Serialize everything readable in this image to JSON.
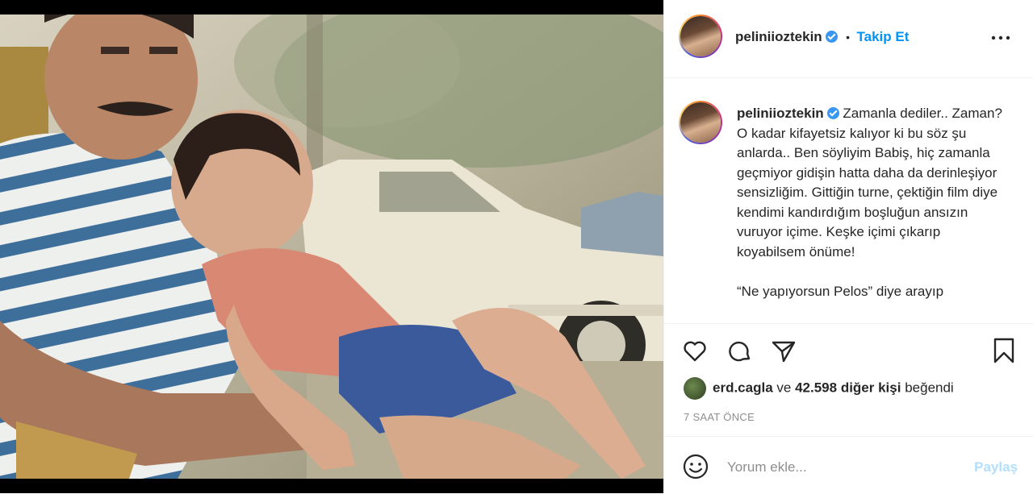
{
  "post": {
    "username": "peliniioztekin",
    "follow_label": "Takip Et",
    "dot": "•",
    "more_icon": "more-horizontal-icon",
    "caption_user": "peliniioztekin",
    "caption_text": " Zamanla dediler.. Zaman? O kadar kifayetsiz kalıyor ki bu söz şu anlarda.. Ben söyliyim Babiş, hiç zamanla geçmiyor gidişin hatta daha da derinleşiyor sensizliğim. Gittiğin turne, çektiğin film diye kendimi kandırdığım boşluğun ansızın vuruyor içime. Keşke içimi çıkarıp koyabilsem önüme!\n\n“Ne yapıyorsun Pelos” diye arayıp",
    "icons": [
      "heart-icon",
      "comment-icon",
      "share-icon",
      "bookmark-icon",
      "emoji-icon",
      "verified-icon"
    ]
  },
  "likes": {
    "liker": "erd.cagla",
    "connector": "ve",
    "count_text": "42.598 diğer kişi",
    "suffix": "beğendi"
  },
  "timestamp": "7 SAAT ÖNCE",
  "comment": {
    "placeholder": "Yorum ekle...",
    "share_label": "Paylaş"
  },
  "colors": {
    "accent": "#0095f6",
    "share_disabled": "#b2dffc",
    "text": "#262626",
    "muted": "#8e8e8e",
    "border": "#efefef"
  }
}
